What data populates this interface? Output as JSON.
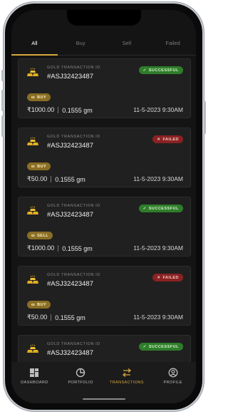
{
  "tabs": [
    {
      "label": "All",
      "active": true
    },
    {
      "label": "Buy",
      "active": false
    },
    {
      "label": "Sell",
      "active": false
    },
    {
      "label": "Failed",
      "active": false
    }
  ],
  "transactions": [
    {
      "id_label": "GOLD TRANSACTION ID",
      "id": "#ASJ32423487",
      "status": "SUCCESSFUL",
      "status_kind": "success",
      "type": "BUY",
      "amount": "₹1000.00",
      "weight": "0.1555 gm",
      "datetime": "11-5-2023  9:30AM"
    },
    {
      "id_label": "GOLD TRANSACTION ID",
      "id": "#ASJ32423487",
      "status": "FAILED",
      "status_kind": "failed",
      "type": "BUY",
      "amount": "₹50.00",
      "weight": "0.1555 gm",
      "datetime": "11-5-2023  9:30AM"
    },
    {
      "id_label": "GOLD TRANSACTION ID",
      "id": "#ASJ32423487",
      "status": "SUCCESSFUL",
      "status_kind": "success",
      "type": "SELL",
      "amount": "₹1000.00",
      "weight": "0.1555 gm",
      "datetime": "11-5-2023  9:30AM"
    },
    {
      "id_label": "GOLD TRANSACTION ID",
      "id": "#ASJ32423487",
      "status": "FAILED",
      "status_kind": "failed",
      "type": "BUY",
      "amount": "₹50.00",
      "weight": "0.1555 gm",
      "datetime": "11-5-2023  9:30AM"
    },
    {
      "id_label": "GOLD TRANSACTION ID",
      "id": "#ASJ32423487",
      "status": "SUCCESSFUL",
      "status_kind": "success",
      "type": "",
      "amount": "",
      "weight": "",
      "datetime": ""
    }
  ],
  "nav": [
    {
      "label": "DASHBOARD",
      "icon": "dashboard-grid-icon",
      "active": false
    },
    {
      "label": "PORTFOLIO",
      "icon": "pie-chart-icon",
      "active": false
    },
    {
      "label": "TRANSACTIONS",
      "icon": "swap-arrows-icon",
      "active": true
    },
    {
      "label": "PROFILE",
      "icon": "user-circle-icon",
      "active": false
    }
  ],
  "colors": {
    "accent": "#d6a93a",
    "success": "#2f7d2a",
    "failed": "#8a2222",
    "background": "#141414",
    "card": "#202020"
  }
}
